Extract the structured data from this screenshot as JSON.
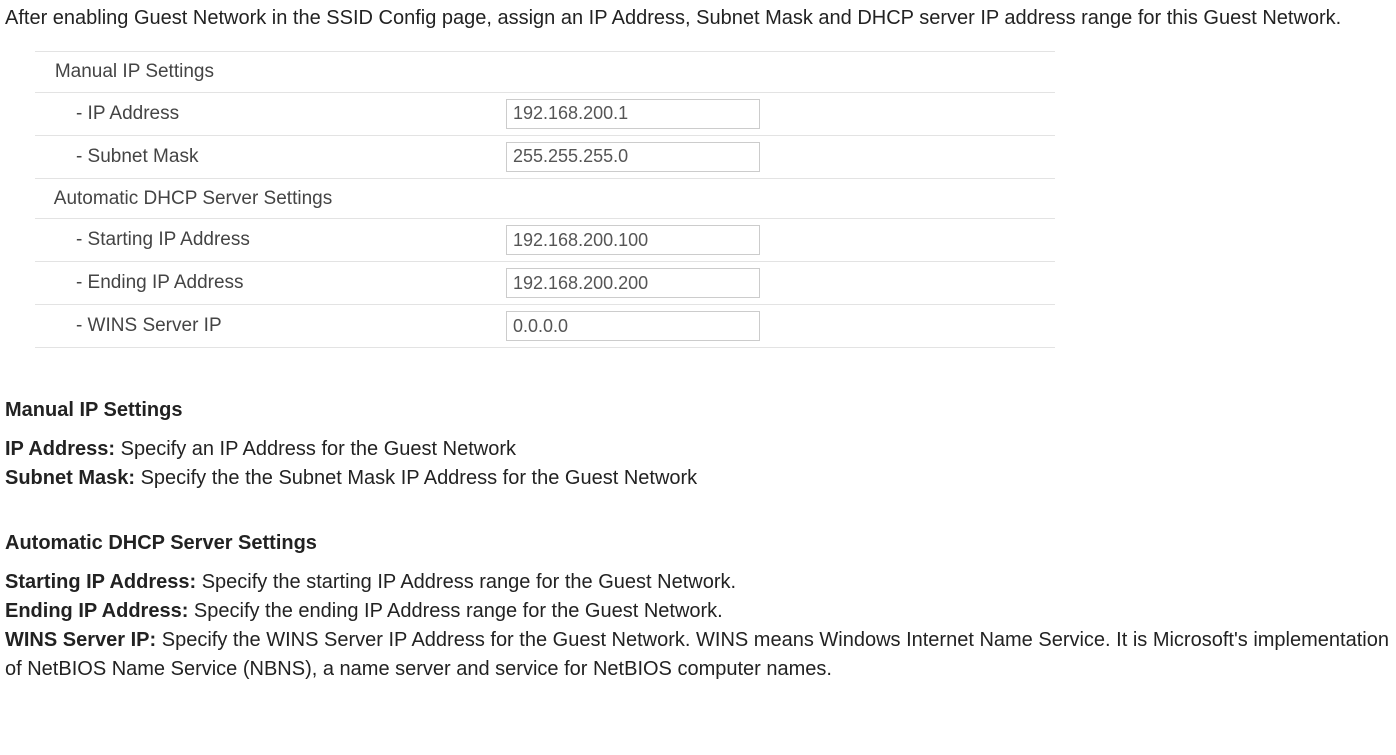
{
  "intro": "After enabling Guest Network in the SSID Config page, assign an IP Address, Subnet Mask and DHCP server IP address range for this Guest Network.",
  "table": {
    "row0_label": "   Manual IP Settings",
    "row1_label": "       - IP Address",
    "row1_value": "192.168.200.1",
    "row2_label": "       - Subnet Mask",
    "row2_value": "255.255.255.0",
    "row3_label": "   Automatic DHCP Server Settings",
    "row4_label": "       - Starting IP Address",
    "row4_value": "192.168.200.100",
    "row5_label": "       - Ending IP Address",
    "row5_value": "192.168.200.200",
    "row6_label": "       - WINS Server IP",
    "row6_value": "0.0.0.0"
  },
  "manual": {
    "title": "Manual IP Settings",
    "ip_label": "IP Address:",
    "ip_desc": " Specify an IP Address for the Guest Network",
    "subnet_label": "Subnet Mask:",
    "subnet_desc": " Specify the the Subnet Mask IP Address for the Guest Network"
  },
  "dhcp": {
    "title": "Automatic DHCP Server Settings",
    "start_label": "Starting IP Address:",
    "start_desc": " Specify the starting IP Address range for the Guest Network.",
    "end_label": "Ending IP Address:",
    "end_desc": " Specify the ending IP Address range for the Guest Network.",
    "wins_label": "WINS Server IP:",
    "wins_desc": " Specify the WINS Server IP Address for the Guest Network. WINS means Windows Internet Name Service. It is Microsoft's implementation of NetBIOS Name Service (NBNS), a name server and service for NetBIOS computer names."
  }
}
